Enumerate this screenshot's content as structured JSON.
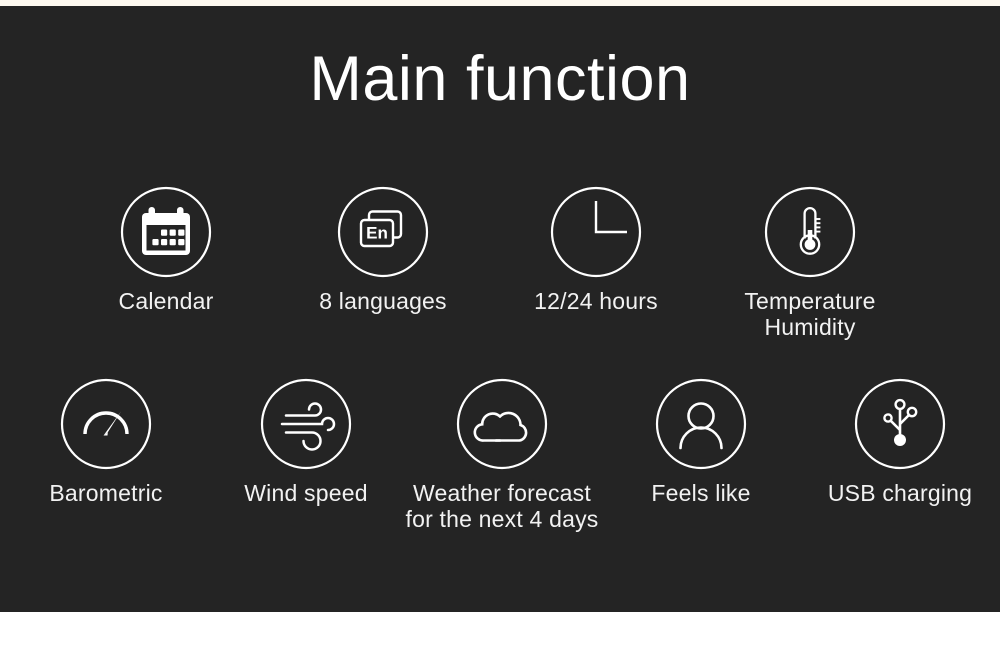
{
  "theme": {
    "panel_background": "#242424",
    "page_background": "#ffffff",
    "top_strip": "#fdf9f0",
    "text_color": "#f2f2f2",
    "title_color": "#ffffff",
    "icon_stroke": "#ffffff"
  },
  "header": {
    "title": "Main function"
  },
  "features": [
    {
      "id": "calendar",
      "label": "Calendar",
      "icon": "calendar-icon"
    },
    {
      "id": "languages",
      "label": "8 languages",
      "icon": "language-cards-icon"
    },
    {
      "id": "hours",
      "label": "12/24 hours",
      "icon": "clock-icon"
    },
    {
      "id": "temperature",
      "label": "Temperature\nHumidity",
      "icon": "thermometer-icon"
    },
    {
      "id": "barometric",
      "label": "Barometric",
      "icon": "gauge-icon"
    },
    {
      "id": "wind",
      "label": "Wind speed",
      "icon": "wind-icon"
    },
    {
      "id": "forecast",
      "label": "Weather forecast\nfor the next 4 days",
      "icon": "cloud-icon"
    },
    {
      "id": "feelslike",
      "label": "Feels like",
      "icon": "person-icon"
    },
    {
      "id": "usb",
      "label": "USB charging",
      "icon": "usb-icon"
    }
  ],
  "icon_text": {
    "language_card": "En"
  }
}
